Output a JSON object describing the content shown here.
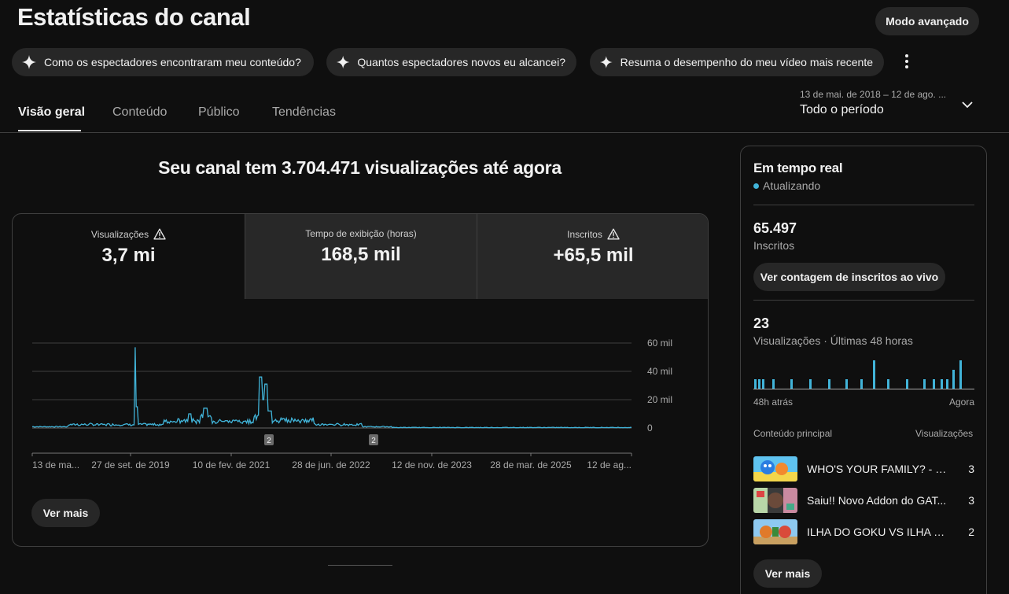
{
  "header": {
    "title": "Estatísticas do canal",
    "advanced_mode": "Modo avançado"
  },
  "chips": [
    {
      "label": "Como os espectadores encontraram meu conteúdo?"
    },
    {
      "label": "Quantos espectadores novos eu alcancei?"
    },
    {
      "label": "Resuma o desempenho do meu vídeo mais recente"
    }
  ],
  "tabs": [
    {
      "label": "Visão geral",
      "active": true
    },
    {
      "label": "Conteúdo"
    },
    {
      "label": "Público"
    },
    {
      "label": "Tendências"
    }
  ],
  "date_range": {
    "range": "13 de mai. de 2018 – 12 de ago. ...",
    "period": "Todo o período"
  },
  "overview": {
    "headline": "Seu canal tem 3.704.471 visualizações até agora",
    "metrics": [
      {
        "label": "Visualizações",
        "value": "3,7 mi",
        "warning": true,
        "selected": true
      },
      {
        "label": "Tempo de exibição (horas)",
        "value": "168,5 mil",
        "warning": false
      },
      {
        "label": "Inscritos",
        "value": "+65,5 mil",
        "warning": true
      }
    ],
    "see_more": "Ver mais"
  },
  "chart_data": {
    "type": "line",
    "series": [
      {
        "values_by_period": "daily views"
      }
    ],
    "y_ticks": [
      "60 mil",
      "40 mil",
      "20 mil",
      "0"
    ],
    "ylim": [
      0,
      60000
    ],
    "x_ticks": [
      "13 de ma...",
      "27 de set. de 2019",
      "10 de fev. de 2021",
      "28 de jun. de 2022",
      "12 de nov. de 2023",
      "28 de mar. de 2025",
      "12 de ag..."
    ],
    "annotations": [
      "2",
      "2"
    ],
    "color": "#41b4d9",
    "peaks": [
      {
        "x": "set. de 2019",
        "y": 57000
      },
      {
        "x": "jan. de 2021",
        "y": 36000
      }
    ]
  },
  "realtime": {
    "title": "Em tempo real",
    "status": "Atualizando",
    "subscribers_value": "65.497",
    "subscribers_label": "Inscritos",
    "live_button": "Ver contagem de inscritos ao vivo",
    "views_value": "23",
    "views_label": "Visualizações · Últimas 48 horas",
    "axis_left": "48h atrás",
    "axis_right": "Agora",
    "top_content_label": "Conteúdo principal",
    "views_col_label": "Visualizações",
    "top_content": [
      {
        "title": "WHO'S YOUR FAMILY? - FIL...",
        "views": "3"
      },
      {
        "title": "Saiu!! Novo Addon do GAT...",
        "views": "3"
      },
      {
        "title": "ILHA DO GOKU VS ILHA DO...",
        "views": "2"
      }
    ],
    "see_more": "Ver mais"
  }
}
